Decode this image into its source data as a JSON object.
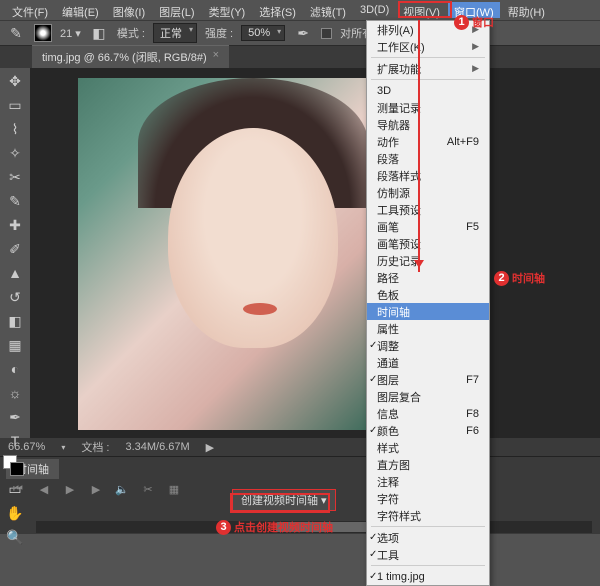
{
  "menubar": {
    "file": "文件(F)",
    "edit": "编辑(E)",
    "image": "图像(I)",
    "layer": "图层(L)",
    "type": "类型(Y)",
    "select": "选择(S)",
    "filter": "滤镜(T)",
    "d3": "3D(D)",
    "view": "视图(V)",
    "window": "窗口(W)",
    "help": "帮助(H)"
  },
  "optbar": {
    "mode_label": "模式 :",
    "mode_value": "正常",
    "strength_label": "强度 :",
    "strength_value": "50%",
    "sample_all": "对所有图层取样"
  },
  "tab": {
    "title": "timg.jpg @ 66.7% (闭眼, RGB/8#)",
    "close": "×"
  },
  "status": {
    "zoom": "66.67%",
    "doc_label": "文档 :",
    "doc_size": "3.34M/6.67M"
  },
  "timeline": {
    "tab": "时间轴",
    "create": "创建视频时间轴"
  },
  "menu": {
    "arrange": "排列(A)",
    "workspace": "工作区(K)",
    "ext": "扩展功能",
    "d3": "3D",
    "measure": "测量记录",
    "nav": "导航器",
    "actions": "动作",
    "actions_sc": "Alt+F9",
    "para": "段落",
    "para_style": "段落样式",
    "clone": "仿制源",
    "tool_preset": "工具预设",
    "brush": "画笔",
    "brush_sc": "F5",
    "brush_preset": "画笔预设",
    "history": "历史记录",
    "paths": "路径",
    "swatches": "色板",
    "timeline": "时间轴",
    "properties": "属性",
    "adjust": "调整",
    "channels": "通道",
    "layers": "图层",
    "layers_sc": "F7",
    "layer_comps": "图层复合",
    "info": "信息",
    "info_sc": "F8",
    "color": "颜色",
    "color_sc": "F6",
    "styles": "样式",
    "histogram": "直方图",
    "notes": "注释",
    "char": "字符",
    "char_style": "字符样式",
    "options": "选项",
    "tools": "工具",
    "doc1": "1 timg.jpg"
  },
  "ann": {
    "a1": "窗口",
    "a2": "时间轴",
    "a3": "点击创建视频时间轴"
  }
}
